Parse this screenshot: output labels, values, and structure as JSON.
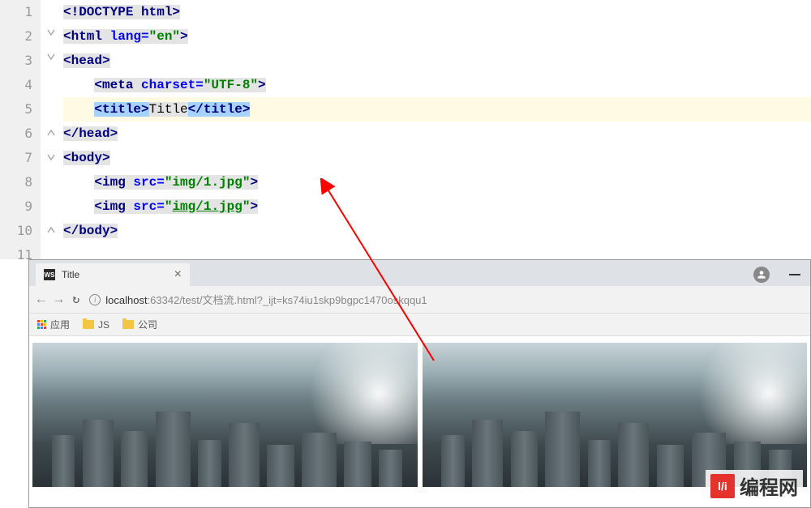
{
  "editor": {
    "line_numbers": [
      "1",
      "2",
      "3",
      "4",
      "5",
      "6",
      "7",
      "8",
      "9",
      "10",
      "11"
    ],
    "lines": {
      "l1": {
        "raw": "<!DOCTYPE html>"
      },
      "l2": {
        "tag_open": "<html ",
        "attr": "lang=",
        "val": "\"en\"",
        "close": ">"
      },
      "l3": {
        "text": "<head>"
      },
      "l4": {
        "tag_open": "<meta ",
        "attr": "charset=",
        "val": "\"UTF-8\"",
        "close": ">"
      },
      "l5": {
        "open": "<title>",
        "content": "Title",
        "close_tag": "</title>"
      },
      "l6": {
        "text": "</head>"
      },
      "l7": {
        "text": "<body>"
      },
      "l8": {
        "tag_open": "<img ",
        "attr": "src=",
        "val": "\"img/1.jpg\"",
        "close": ">"
      },
      "l9": {
        "tag_open": "<img ",
        "attr": "src=",
        "val_open": "\"",
        "val_link": "img/1.jpg",
        "val_close": "\"",
        "close": ">"
      },
      "l10": {
        "text": "</body>"
      }
    }
  },
  "browser": {
    "tab_title": "Title",
    "tab_icon_text": "WS",
    "url_host": "localhost",
    "url_port_path": ":63342/test/文档流.html?_ijt=ks74iu1skp9bgpc1470oskqqu1",
    "bookmarks": {
      "apps": "应用",
      "js": "JS",
      "company": "公司"
    }
  },
  "logo": {
    "icon": "l/i",
    "text": "编程网"
  }
}
